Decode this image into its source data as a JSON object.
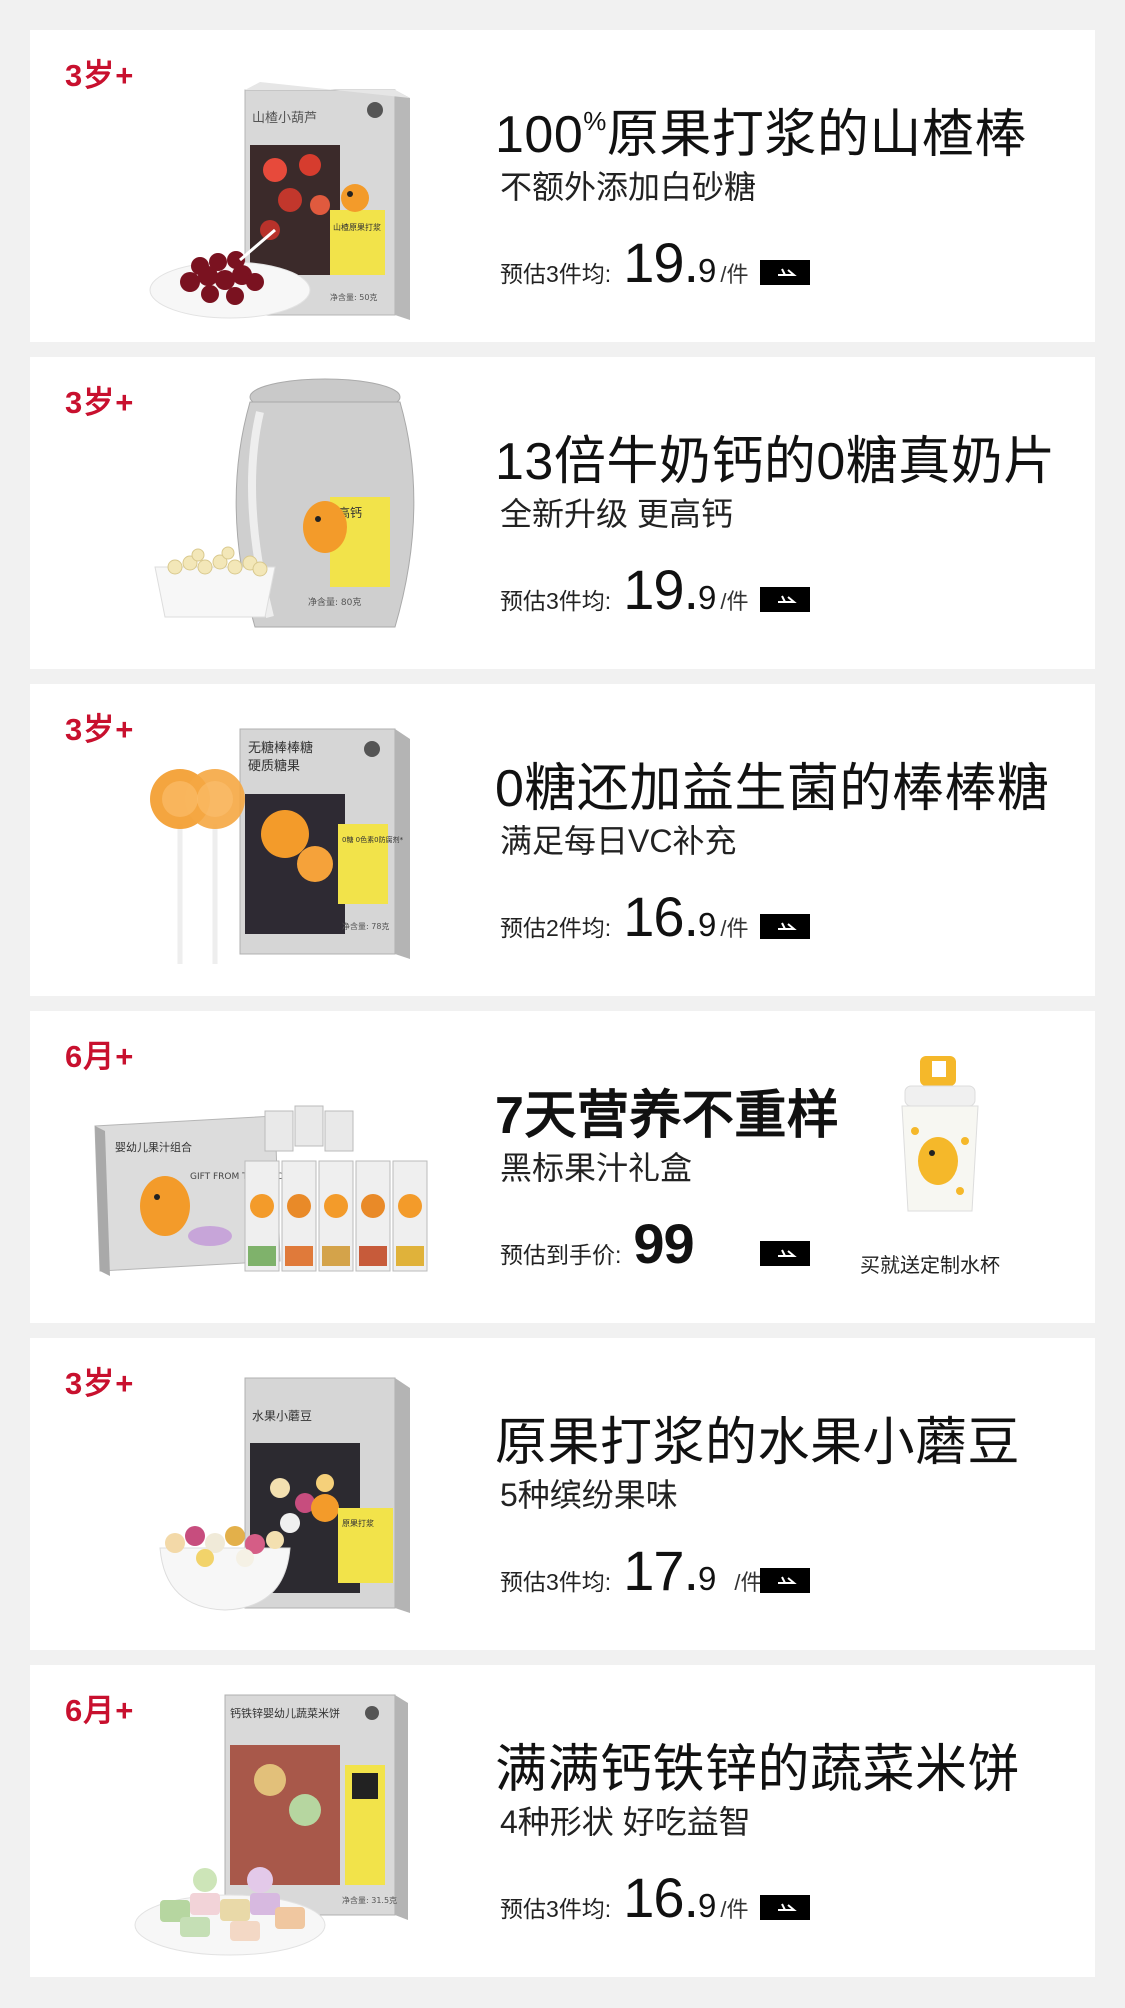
{
  "products": [
    {
      "age": "3岁+",
      "headline_main": "100",
      "headline_sup": "%",
      "headline_rest": "原果打浆的山楂棒",
      "subline": "不额外添加白砂糖",
      "price_label": "预估3件均:",
      "price_int": "19.",
      "price_dec": "9",
      "price_unit": "/件",
      "box_title": "山楂小葫芦",
      "box_tag": "山楂原果打浆",
      "box_net": "净含量: 50克"
    },
    {
      "age": "3岁+",
      "headline": "13倍牛奶钙的0糖真奶片",
      "subline": "全新升级 更高钙",
      "price_label": "预估3件均:",
      "price_int": "19.",
      "price_dec": "9",
      "price_unit": "/件",
      "box_title": "高钙",
      "box_net": "净含量: 80克"
    },
    {
      "age": "3岁+",
      "headline": "0糖还加益生菌的棒棒糖",
      "subline": "满足每日VC补充",
      "price_label": "预估2件均:",
      "price_int": "16.",
      "price_dec": "9",
      "price_unit": "/件",
      "box_title": "无糖棒棒糖",
      "box_subtitle": "硬质糖果",
      "box_tag": "0糖 0色素0防腐剂*",
      "box_net": "净含量: 78克"
    },
    {
      "age": "6月+",
      "headline": "7天营养不重样",
      "subline": "黑标果汁礼盒",
      "price_label": "预估到手价:",
      "price_int": "99",
      "price_dec": "",
      "price_unit": "",
      "box_title": "婴幼儿果汁组合",
      "box_subtitle": "GIFT FROM THE QUOTATOR",
      "gift_label": "买就送定制水杯"
    },
    {
      "age": "3岁+",
      "headline": "原果打浆的水果小蘑豆",
      "subline": "5种缤纷果味",
      "price_label": "预估3件均:",
      "price_int": "17.",
      "price_dec": "9",
      "price_unit": "/件",
      "box_title": "水果小蘑豆",
      "box_tag": "原果打浆"
    },
    {
      "age": "6月+",
      "headline": "满满钙铁锌的蔬菜米饼",
      "subline": "4种形状 好吃益智",
      "price_label": "预估3件均:",
      "price_int": "16.",
      "price_dec": "9",
      "price_unit": "/件",
      "box_title": "钙铁锌婴幼儿蔬菜米饼",
      "box_net": "净含量: 31.5克"
    }
  ],
  "colors": {
    "age_red": "#c8102e",
    "page_bg": "#f1f1f1",
    "card_bg": "#ffffff",
    "tag_yellow": "#f2e34a",
    "mascot_orange": "#f39b2a"
  },
  "icons": {
    "buy": "airplane-icon",
    "mascot": "dinosaur-mascot"
  }
}
